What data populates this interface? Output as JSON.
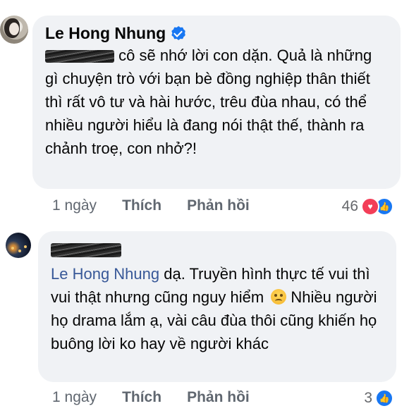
{
  "comments": [
    {
      "author": "Le Hong Nhung",
      "verified": true,
      "text": "cô sẽ nhớ lời con dặn. Quả là những gì chuyện trò với bạn bè đồng nghiệp thân thiết thì rất vô tư và hài hước, trêu đùa nhau, có thể nhiều người hiểu là đang nói thật thế, thành ra chảnh troẹ, con nhở?!",
      "time": "1 ngày",
      "like_label": "Thích",
      "reply_label": "Phản hồi",
      "reaction_count": "46",
      "reactions": [
        "heart-icon",
        "like-icon"
      ]
    },
    {
      "mention": "Le Hong Nhung",
      "text": "dạ. Truyền hình thực tế vui thì vui thật nhưng cũng nguy hiểm",
      "text2": "Nhiều người họ drama lắm ạ, vài câu đùa thôi cũng khiến họ buông lời ko hay về người khác",
      "time": "1 ngày",
      "like_label": "Thích",
      "reply_label": "Phản hồi",
      "reaction_count": "3",
      "reactions": [
        "like-icon"
      ]
    }
  ],
  "colors": {
    "bubble": "#f0f2f5",
    "mention": "#385898",
    "verified": "#1877f2",
    "heart": "#f33e58",
    "like": "#1877f2"
  }
}
